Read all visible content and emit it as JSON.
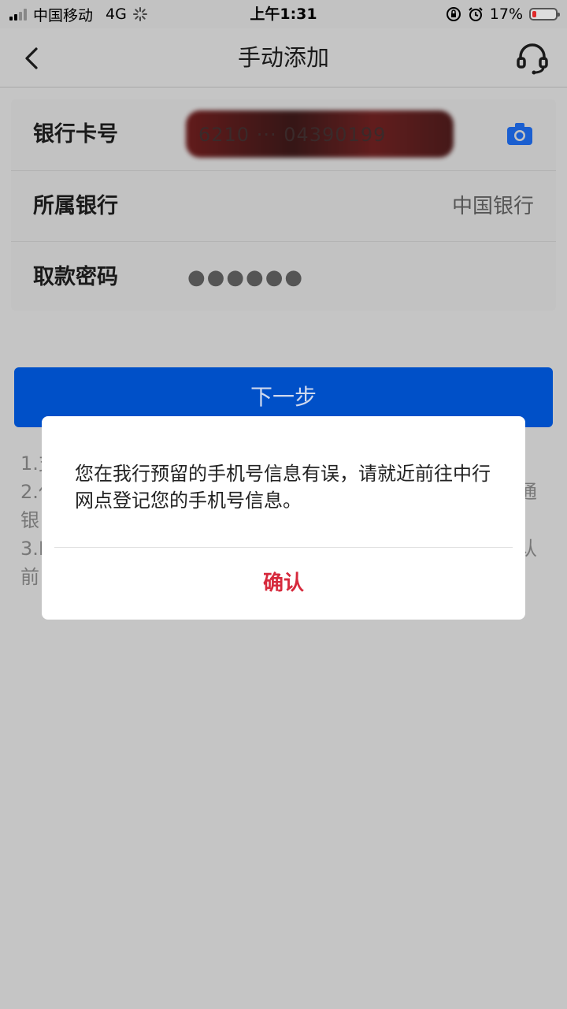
{
  "status_bar": {
    "carrier": "中国移动",
    "network": "4G",
    "time": "上午1:31",
    "battery": "17%",
    "battery_fraction": 0.17
  },
  "nav": {
    "title": "手动添加",
    "back_icon": "chevron-left-icon",
    "support_icon": "headset-icon"
  },
  "form": {
    "card_number_label": "银行卡号",
    "card_number_value": "6210 ··· 04390199",
    "bank_label": "所属银行",
    "bank_value": "中国银行",
    "password_label": "取款密码",
    "password_value": "●●●●●●"
  },
  "next_button": "下一步",
  "notes": {
    "line1": "1.支",
    "line2_left": "2.仅",
    "line2_right": "通",
    "line3": "银",
    "line4_left": "3.I",
    "line4_right": "认",
    "line5": "前"
  },
  "dialog": {
    "message": "您在我行预留的手机号信息有误，请就近前往中行网点登记您的手机号信息。",
    "confirm": "确认"
  },
  "colors": {
    "primary_blue": "#0050c8",
    "confirm_red": "#d6293c",
    "overlay_gray": "#c5c5c5"
  }
}
